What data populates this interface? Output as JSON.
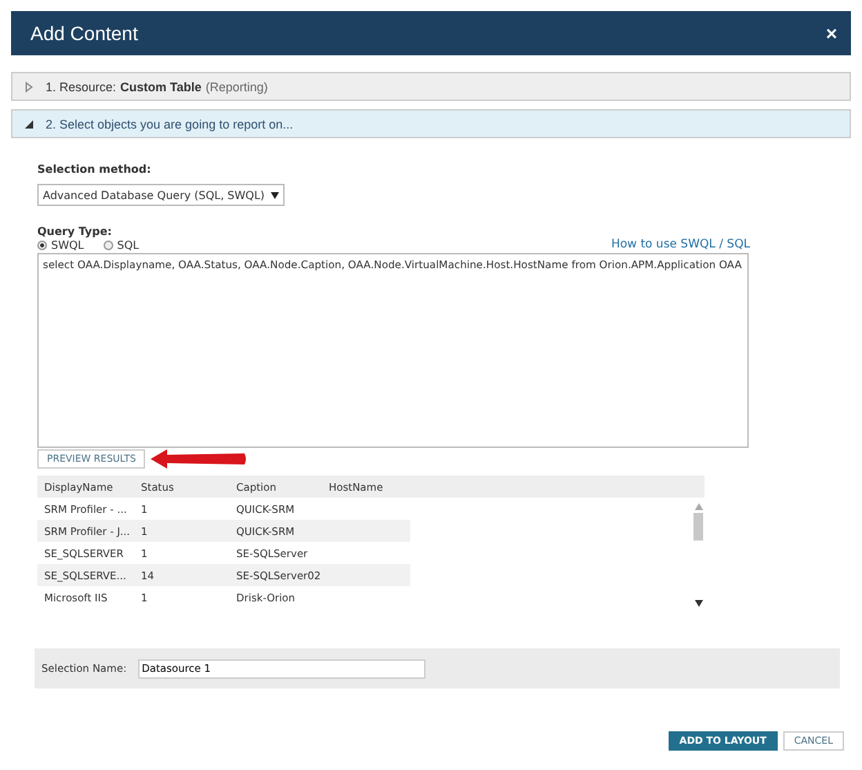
{
  "dialog": {
    "title": "Add Content",
    "close": "×"
  },
  "sections": [
    {
      "number": "1. Resource:",
      "name": "Custom Table",
      "note": "(Reporting)",
      "expanded": false
    },
    {
      "number": "2. Select objects you are going to report on...",
      "expanded": true
    }
  ],
  "selection_method": {
    "label": "Selection method:",
    "value": "Advanced Database Query (SQL, SWQL)"
  },
  "query_type": {
    "label": "Query Type:",
    "options": [
      {
        "label": "SWQL",
        "selected": true
      },
      {
        "label": "SQL",
        "selected": false
      }
    ],
    "help_link": "How to use SWQL / SQL"
  },
  "query": "select OAA.Displayname, OAA.Status, OAA.Node.Caption, OAA.Node.VirtualMachine.Host.HostName from Orion.APM.Application OAA",
  "preview_button": "PREVIEW RESULTS",
  "table": {
    "columns": [
      "DisplayName",
      "Status",
      "Caption",
      "HostName"
    ],
    "rows": [
      [
        "SRM Profiler - ...",
        "1",
        "QUICK-SRM",
        ""
      ],
      [
        "SRM Profiler - J...",
        "1",
        "QUICK-SRM",
        ""
      ],
      [
        "SE_SQLSERVER",
        "1",
        "SE-SQLServer",
        ""
      ],
      [
        "SE_SQLSERVE...",
        "14",
        "SE-SQLServer02",
        ""
      ],
      [
        "Microsoft IIS",
        "1",
        "Drisk-Orion",
        ""
      ]
    ]
  },
  "selection_name": {
    "label": "Selection Name:",
    "value": "Datasource 1"
  },
  "buttons": [
    {
      "label": "ADD TO LAYOUT",
      "kind": "primary"
    },
    {
      "label": "CANCEL",
      "kind": "secondary"
    }
  ]
}
